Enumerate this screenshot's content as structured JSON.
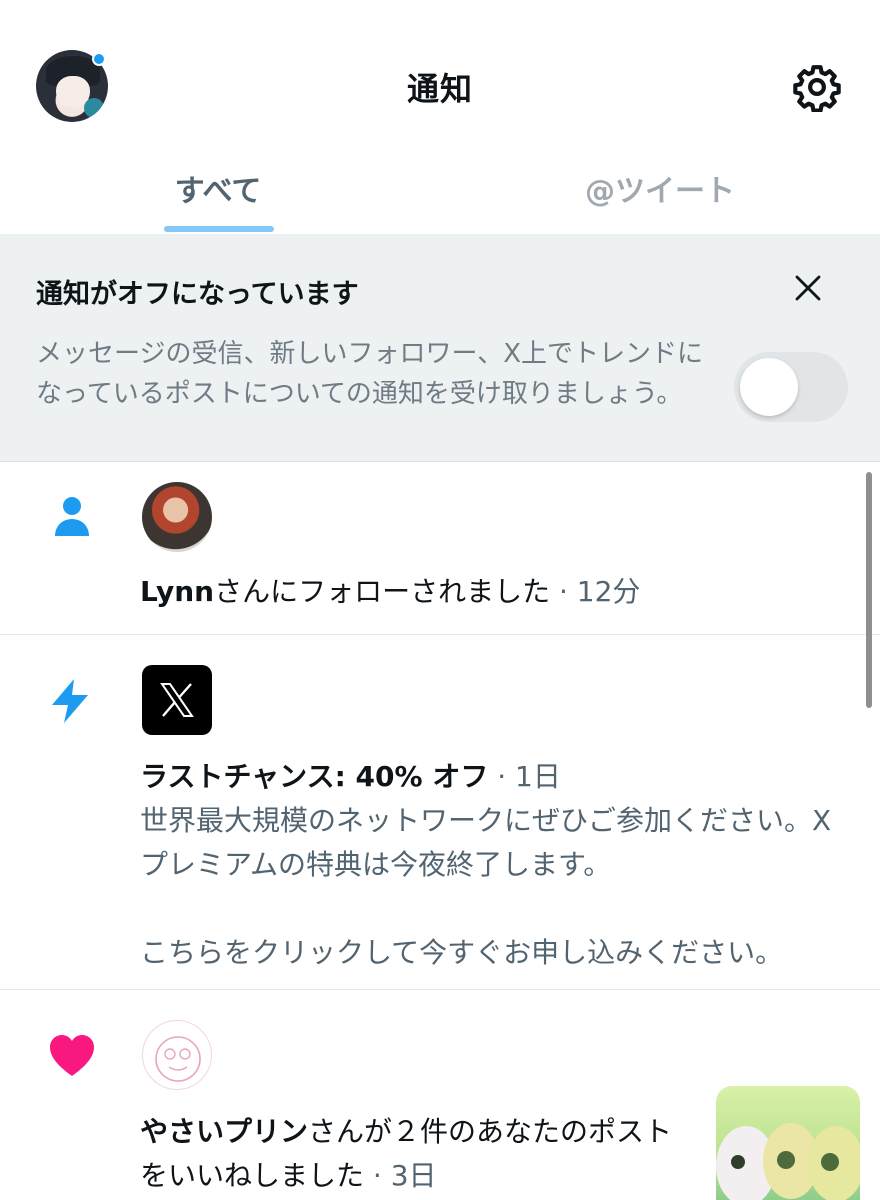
{
  "header": {
    "title": "通知",
    "avatar_icon": "user-avatar",
    "settings_icon": "gear-icon"
  },
  "tabs": [
    {
      "label": "すべて",
      "active": true
    },
    {
      "label": "@ツイート",
      "active": false
    }
  ],
  "banner": {
    "title": "通知がオフになっています",
    "text": "メッセージの受信、新しいフォロワー、X上でトレンドになっているポストについての通知を受け取りましょう。",
    "toggle_on": false
  },
  "notifications": [
    {
      "type": "follow",
      "icon": "person-icon",
      "user": "Lynn",
      "action": "さんにフォローされました",
      "time": "· 12分"
    },
    {
      "type": "promo",
      "icon": "lightning-icon",
      "headline": "ラストチャンス: 40% オフ",
      "time": "· 1日",
      "body_line1": "世界最大規模のネットワークにぜひご参加ください。X プレミアムの特典は今夜終了します。",
      "body_line2": "こちらをクリックして今すぐお申し込みください。"
    },
    {
      "type": "like",
      "icon": "heart-icon",
      "user": "やさいプリン",
      "action": "さんが２件のあなたのポストをいいねしました",
      "time": "· 3日"
    }
  ],
  "colors": {
    "accent": "#1d9bf0",
    "like": "#f91880",
    "banner_bg": "#eef1f2"
  }
}
